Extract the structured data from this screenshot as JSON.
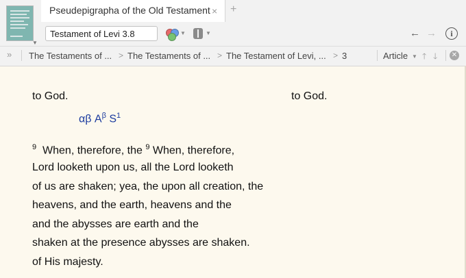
{
  "tab": {
    "title": "Pseudepigrapha of the Old Testament",
    "close": "×",
    "add": "+"
  },
  "toolbar": {
    "reference_value": "Testament of Levi 3.8"
  },
  "breadcrumb": {
    "expand": "»",
    "items": [
      "The Testaments of ...",
      "The Testaments of ...",
      "The Testament of Levi, ...",
      "3"
    ],
    "separator": ">",
    "article_label": "Article"
  },
  "text": {
    "top_left": "to God.",
    "top_right": "to God.",
    "sigla": {
      "main": "αβ",
      "a_base": "A",
      "a_sup": "β",
      "s_base": "S",
      "s_sup": "1"
    },
    "lines": [
      {
        "num1": "9",
        "pre": "When,   therefore,   the",
        "num2": "9",
        "post": "When, therefore,"
      },
      {
        "pre": "Lord  looketh  upon  us,  all",
        "post": "the Lord looketh"
      },
      {
        "pre": "of  us are shaken; yea, the",
        "post": "upon all creation, the"
      },
      {
        "pre": "heavens,   and   the   earth,",
        "post": "heavens and the"
      },
      {
        "pre": "and     the     abysses     are",
        "post": "earth and the"
      },
      {
        "pre": "shaken   at   the   presence",
        "post": "abysses are shaken."
      },
      {
        "pre": "of His majesty.",
        "post": ""
      }
    ]
  }
}
